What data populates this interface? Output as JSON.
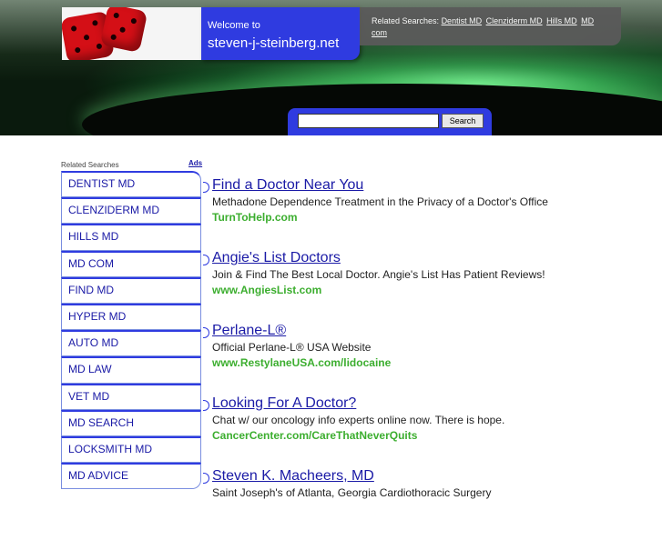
{
  "header": {
    "welcome_small": "Welcome to",
    "site_name": "steven-j-steinberg.net",
    "related_label": "Related Searches:",
    "related_links": [
      "Dentist MD",
      "Clenziderm MD",
      "Hills MD",
      "MD com"
    ]
  },
  "search": {
    "placeholder": "",
    "button_label": "Search"
  },
  "left": {
    "title": "Related Searches",
    "ads_label": "Ads",
    "items": [
      "DENTIST MD",
      "CLENZIDERM MD",
      "HILLS MD",
      "MD COM",
      "FIND MD",
      "HYPER MD",
      "AUTO MD",
      "MD LAW",
      "VET MD",
      "MD SEARCH",
      "LOCKSMITH MD",
      "MD ADVICE"
    ]
  },
  "ads": [
    {
      "title": "Find a Doctor Near You",
      "desc": "Methadone Dependence Treatment in the Privacy of a Doctor's Office",
      "url": "TurnToHelp.com"
    },
    {
      "title": "Angie's List Doctors",
      "desc": "Join & Find The Best Local Doctor. Angie's List Has Patient Reviews!",
      "url": "www.AngiesList.com"
    },
    {
      "title": "Perlane-L®",
      "desc": "Official Perlane-L® USA Website",
      "url": "www.RestylaneUSA.com/lidocaine"
    },
    {
      "title": "Looking For A Doctor?",
      "desc": "Chat w/ our oncology info experts online now. There is hope.",
      "url": "CancerCenter.com/CareThatNeverQuits"
    },
    {
      "title": "Steven K. Macheers, MD",
      "desc": "Saint Joseph's of Atlanta, Georgia Cardiothoracic Surgery",
      "url": ""
    }
  ],
  "colors": {
    "accent": "#2f3be0",
    "link": "#1a1aa6",
    "url_green": "#3cae2f"
  }
}
